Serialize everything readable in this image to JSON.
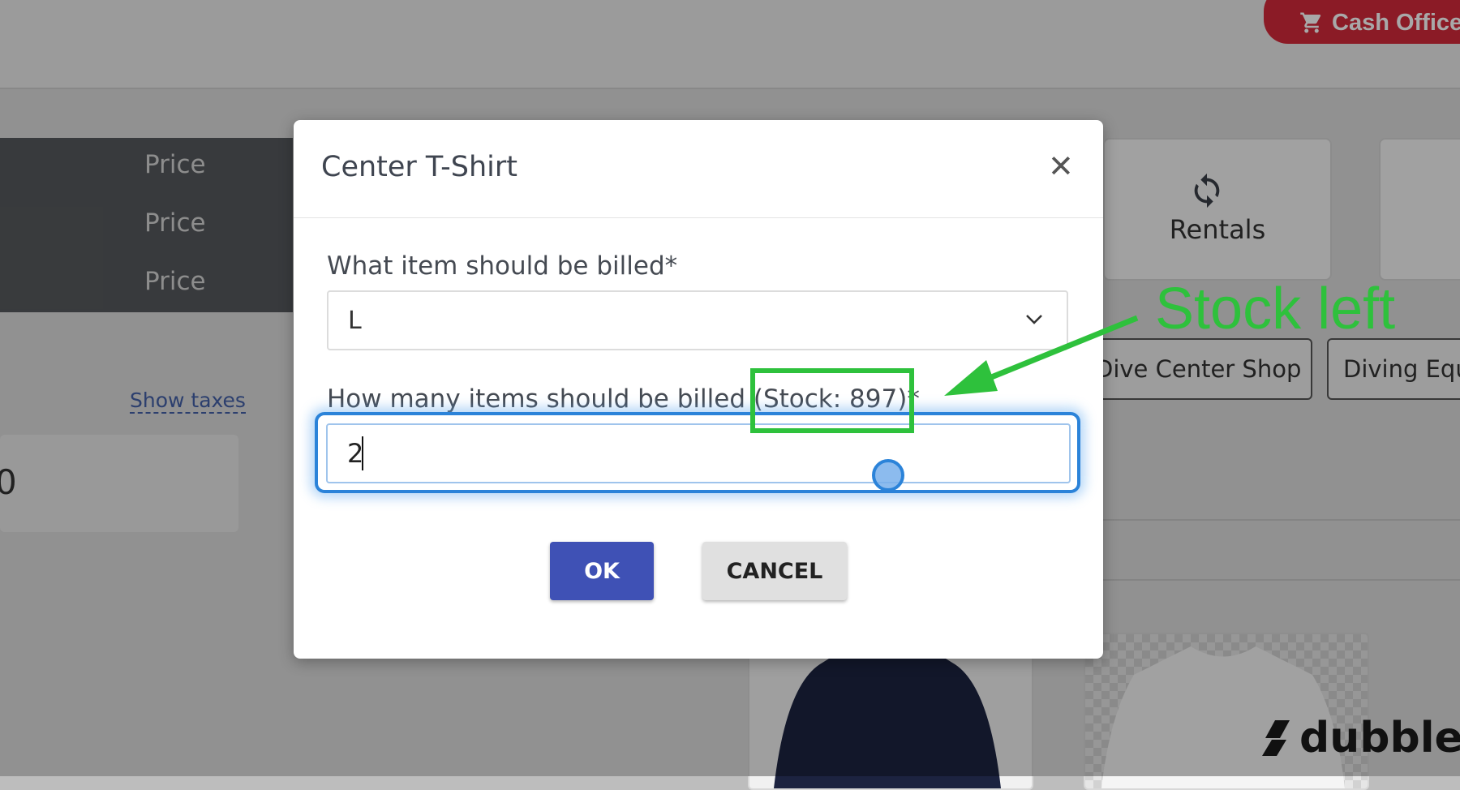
{
  "header": {
    "cash_button_label": "Cash Office",
    "cart_icon": "cart-icon"
  },
  "background": {
    "price_rows": [
      "Price",
      "Price",
      "Price"
    ],
    "show_taxes_link": "Show taxes",
    "total_fragment": "0",
    "rentals_tile_label": "Rentals",
    "rentals_icon": "sync-icon",
    "categories": [
      "Dive Center Shop",
      "Diving Equipment"
    ]
  },
  "modal": {
    "title": "Center T-Shirt",
    "close_icon": "close-icon",
    "item_label": "What item should be billed*",
    "item_value": "L",
    "quantity_label_prefix": "How many items should be billed ",
    "quantity_label_stock": "(Stock: 897)",
    "quantity_label_suffix": "*",
    "quantity_value": "2",
    "ok_label": "OK",
    "cancel_label": "CANCEL"
  },
  "annotation": {
    "text": "Stock left",
    "color": "#2ec13c"
  },
  "watermark": {
    "text": "dubble"
  }
}
